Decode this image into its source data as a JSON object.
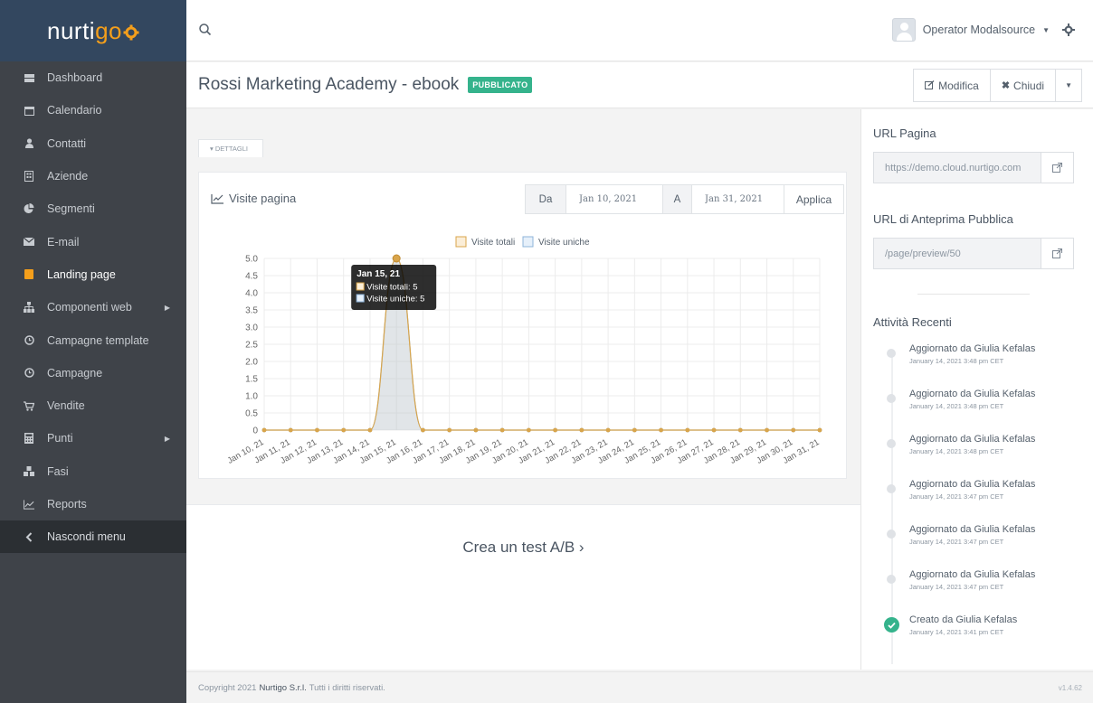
{
  "brand": {
    "name_start": "nurti",
    "name_accent": "go"
  },
  "sidebar": {
    "items": [
      {
        "label": "Dashboard",
        "icon": "th-large-icon"
      },
      {
        "label": "Calendario",
        "icon": "calendar-icon"
      },
      {
        "label": "Contatti",
        "icon": "user-icon"
      },
      {
        "label": "Aziende",
        "icon": "building-icon"
      },
      {
        "label": "Segmenti",
        "icon": "pie-chart-icon"
      },
      {
        "label": "E-mail",
        "icon": "envelope-icon"
      },
      {
        "label": "Landing page",
        "icon": "file-icon"
      },
      {
        "label": "Componenti web",
        "icon": "sitemap-icon"
      },
      {
        "label": "Campagne template",
        "icon": "clock-icon"
      },
      {
        "label": "Campagne",
        "icon": "clock-icon"
      },
      {
        "label": "Vendite",
        "icon": "cart-icon"
      },
      {
        "label": "Punti",
        "icon": "calculator-icon"
      },
      {
        "label": "Fasi",
        "icon": "cubes-icon"
      },
      {
        "label": "Reports",
        "icon": "line-chart-icon"
      }
    ],
    "hide_menu_label": "Nascondi menu",
    "active_index": 6,
    "accent_color": "#f59f1b"
  },
  "topbar": {
    "user_name": "Operator Modalsource"
  },
  "header": {
    "title": "Rossi Marketing Academy - ebook",
    "status": "PUBBLICATO",
    "status_color": "#35b38c",
    "edit_label": "Modifica",
    "close_label": "Chiudi"
  },
  "details_tab": "▾ DETTAGLI",
  "visits": {
    "title": "Visite pagina",
    "from_label": "Da",
    "from_value": "Jan 10, 2021",
    "to_label": "A",
    "to_value": "Jan 31, 2021",
    "apply_label": "Applica"
  },
  "chart_data": {
    "type": "line",
    "categories": [
      "Jan 10, 21",
      "Jan 11, 21",
      "Jan 12, 21",
      "Jan 13, 21",
      "Jan 14, 21",
      "Jan 15, 21",
      "Jan 16, 21",
      "Jan 17, 21",
      "Jan 18, 21",
      "Jan 19, 21",
      "Jan 20, 21",
      "Jan 21, 21",
      "Jan 22, 21",
      "Jan 23, 21",
      "Jan 24, 21",
      "Jan 25, 21",
      "Jan 26, 21",
      "Jan 27, 21",
      "Jan 28, 21",
      "Jan 29, 21",
      "Jan 30, 21",
      "Jan 31, 21"
    ],
    "series": [
      {
        "name": "Visite totali",
        "values": [
          0,
          0,
          0,
          0,
          0,
          5,
          0,
          0,
          0,
          0,
          0,
          0,
          0,
          0,
          0,
          0,
          0,
          0,
          0,
          0,
          0,
          0
        ],
        "color": "#d9a54b"
      },
      {
        "name": "Visite uniche",
        "values": [
          0,
          0,
          0,
          0,
          0,
          5,
          0,
          0,
          0,
          0,
          0,
          0,
          0,
          0,
          0,
          0,
          0,
          0,
          0,
          0,
          0,
          0
        ],
        "color": "#8fb4d9"
      }
    ],
    "yticks": [
      "5.0",
      "4.5",
      "4.0",
      "3.5",
      "3.0",
      "2.5",
      "2.0",
      "1.5",
      "1.0",
      "0.5",
      "0"
    ],
    "ylim": [
      0,
      5
    ],
    "legend": "top-center",
    "grid": true,
    "tooltip": {
      "title": "Jan 15, 21",
      "line1": "Visite totali: 5",
      "line2": "Visite uniche: 5"
    }
  },
  "ab_test_label": "Crea un test A/B ›",
  "right_panel": {
    "url_heading": "URL Pagina",
    "url_value": "https://demo.cloud.nurtigo.com",
    "preview_heading": "URL di Anteprima Pubblica",
    "preview_value": "/page/preview/50",
    "activity_heading": "Attività Recenti",
    "activities": [
      {
        "title": "Aggiornato da Giulia Kefalas",
        "time": "January 14, 2021 3:48 pm CET"
      },
      {
        "title": "Aggiornato da Giulia Kefalas",
        "time": "January 14, 2021 3:48 pm CET"
      },
      {
        "title": "Aggiornato da Giulia Kefalas",
        "time": "January 14, 2021 3:48 pm CET"
      },
      {
        "title": "Aggiornato da Giulia Kefalas",
        "time": "January 14, 2021 3:47 pm CET"
      },
      {
        "title": "Aggiornato da Giulia Kefalas",
        "time": "January 14, 2021 3:47 pm CET"
      },
      {
        "title": "Aggiornato da Giulia Kefalas",
        "time": "January 14, 2021 3:47 pm CET"
      },
      {
        "title": "Creato da Giulia Kefalas",
        "time": "January 14, 2021 3:41 pm CET"
      }
    ]
  },
  "footer": {
    "prefix": "Copyright 2021",
    "company": "Nurtigo S.r.l.",
    "suffix": "Tutti i diritti riservati.",
    "version": "v1.4.62"
  }
}
